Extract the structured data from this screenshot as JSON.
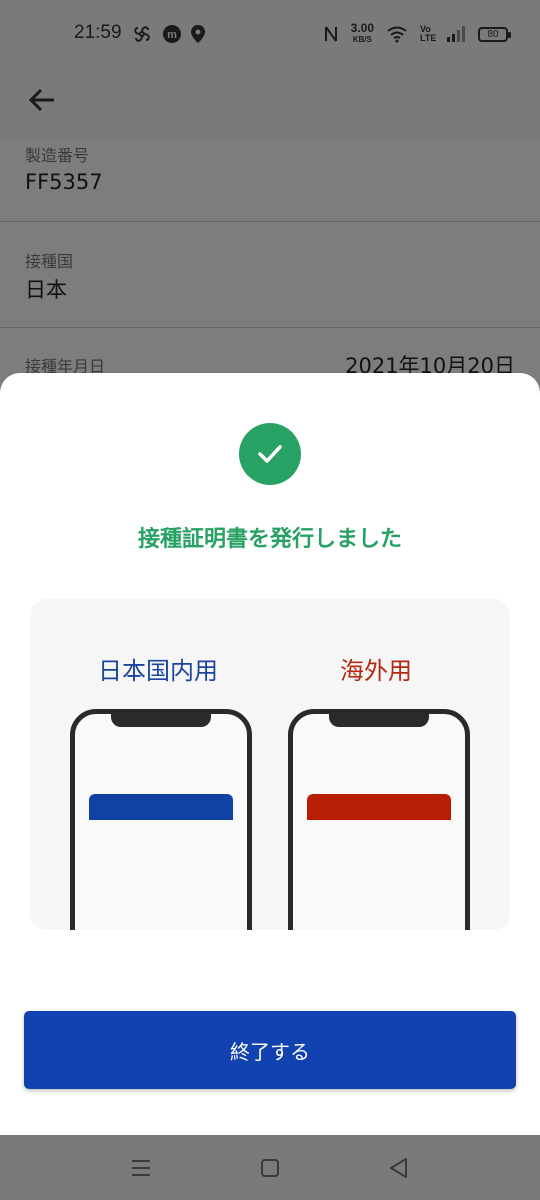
{
  "status_bar": {
    "time": "21:59",
    "net_speed_value": "3.00",
    "net_speed_unit": "KB/S",
    "volte_label": "Vo LTE",
    "battery": "80"
  },
  "background": {
    "fields": [
      {
        "label": "製造番号",
        "value": "FF5357"
      },
      {
        "label": "接種国",
        "value": "日本"
      },
      {
        "label": "接種年月日",
        "value": "2021年10月20日"
      }
    ]
  },
  "sheet": {
    "title": "接種証明書を発行しました",
    "domestic_label": "日本国内用",
    "overseas_label": "海外用",
    "finish_button": "終了する"
  },
  "colors": {
    "success_green": "#27a164",
    "domestic_blue": "#1241a6",
    "overseas_red": "#b81e06",
    "button_blue": "#1241b0"
  },
  "icons": {
    "back": "arrow-left-icon",
    "check": "check-icon",
    "nav_menu": "menu-icon",
    "nav_home": "square-icon",
    "nav_back": "triangle-back-icon"
  }
}
